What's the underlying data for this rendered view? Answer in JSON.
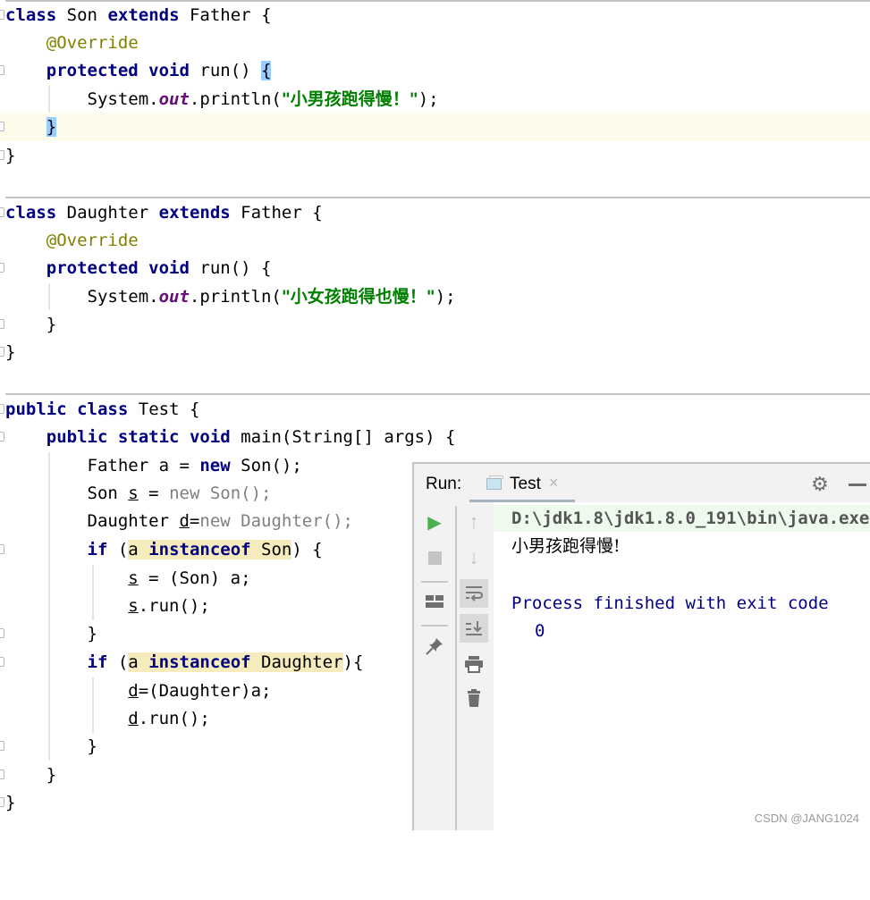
{
  "editor": {
    "son_class": {
      "decl": [
        "class",
        "Son",
        "extends",
        "Father",
        "{"
      ],
      "annotation": "@Override",
      "method": [
        "protected",
        "void",
        "run() ",
        "{"
      ],
      "print_prefix": "System.",
      "print_field": "out",
      "print_call": ".println(",
      "print_string": "\"小男孩跑得慢！\"",
      "print_suffix": ");",
      "close_method": "}",
      "close_class": "}"
    },
    "daughter_class": {
      "decl": [
        "class",
        "Daughter",
        "extends",
        "Father",
        "{"
      ],
      "annotation": "@Override",
      "method": [
        "protected",
        "void",
        "run() {"
      ],
      "print_prefix": "System.",
      "print_field": "out",
      "print_call": ".println(",
      "print_string": "\"小女孩跑得也慢！\"",
      "print_suffix": ");",
      "close_method": "}",
      "close_class": "}"
    },
    "test_class": {
      "decl": [
        "public",
        "class",
        "Test {"
      ],
      "main": [
        "public",
        "static",
        "void",
        "main(String[] args) {"
      ],
      "line_a": [
        "Father a = ",
        "new",
        " Son();"
      ],
      "line_s": [
        "Son ",
        "s",
        " = ",
        "new Son();"
      ],
      "line_d": [
        "Daughter ",
        "d",
        "=",
        "new Daughter();"
      ],
      "if_son": [
        "if",
        " (",
        "a ",
        "instanceof",
        " Son",
        ") {"
      ],
      "cast_s": [
        "s",
        " = (Son) a;"
      ],
      "run_s": [
        "s",
        ".run();"
      ],
      "close_if1": "}",
      "if_daughter": [
        "if",
        " (",
        "a ",
        "instanceof",
        " Daughter",
        "){"
      ],
      "cast_d": [
        "d",
        "=(Daughter)a;"
      ],
      "run_d": [
        "d",
        ".run();"
      ],
      "close_if2": "}",
      "close_main": "}",
      "close_class": "}"
    }
  },
  "run_panel": {
    "label": "Run:",
    "tab": {
      "label": "Test",
      "close": "×"
    },
    "icons": {
      "gear": "⚙",
      "rerun": "▶",
      "stop": "■",
      "up": "↑",
      "down": "↓"
    },
    "console": {
      "command": "D:\\jdk1.8\\jdk1.8.0_191\\bin\\java.exe",
      "output": "小男孩跑得慢!",
      "exit_line1": "Process finished with exit code",
      "exit_line2": "0"
    }
  },
  "watermark": "CSDN @JANG1024",
  "colors": {
    "keyword": "#000080",
    "annotation": "#808000",
    "string": "#008000",
    "static_field": "#660e7a",
    "highlight": "#f6ebbc",
    "run_green": "#4caf50"
  }
}
